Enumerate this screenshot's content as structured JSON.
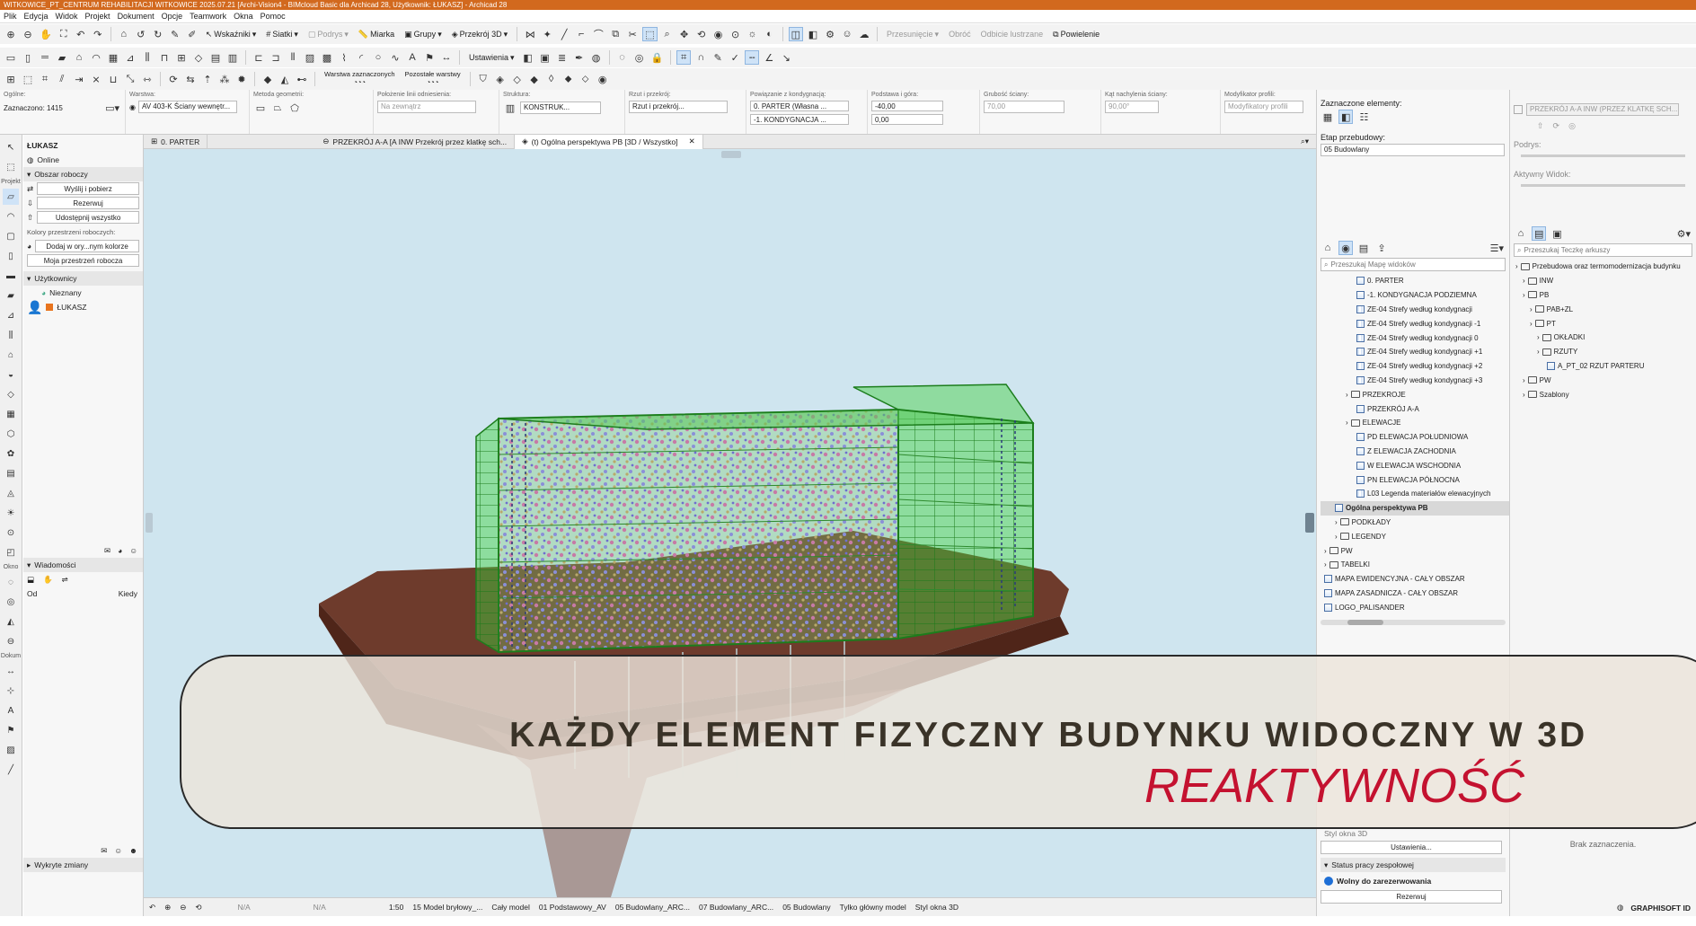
{
  "window": {
    "title": "WITKOWICE_PT_CENTRUM REHABILITACJI WITKOWICE 2025.07.21 [Archi-Vision4 - BIMcloud Basic dla Archicad 28, Użytkownik: ŁUKASZ] - Archicad 28"
  },
  "menu": [
    "Plik",
    "Edycja",
    "Widok",
    "Projekt",
    "Dokument",
    "Opcje",
    "Teamwork",
    "Okna",
    "Pomoc"
  ],
  "toolbar": {
    "wskazniki": "Wskaźniki",
    "siatki": "Siatki",
    "podrys": "Podrys",
    "miarka": "Miarka",
    "grupy": "Grupy",
    "przekroj3d": "Przekrój 3D",
    "przesuniecie": "Przesunięcie",
    "obroc": "Obróć",
    "odbicie": "Odbicie lustrzane",
    "powielenie": "Powielenie",
    "ustawienia": "Ustawienia",
    "warstwa": "Warstwa zaznaczonych",
    "pozostale": "Pozostałe warstwy"
  },
  "infobox": {
    "ogolne": "Ogólne:",
    "zaznaczono": "Zaznaczono: 1415",
    "warstwa_l": "Warstwa:",
    "warstwa_v": "AV 403-K Ściany wewnętr...",
    "metoda_l": "Metoda geometrii:",
    "polozenie_l": "Położenie linii odniesienia:",
    "polozenie_v": "Na zewnątrz",
    "struktura_l": "Struktura:",
    "struktura_v": "KONSTRUK...",
    "rzut_l": "Rzut i przekrój:",
    "rzut_v": "Rzut i przekrój...",
    "powiazanie_l": "Powiązanie z kondygnacją:",
    "pow1": "0. PARTER (Własna ...",
    "pow2": "-1. KONDYGNACJA ...",
    "podstawa_l": "Podstawa i góra:",
    "pod1": "-40,00",
    "pod2": "0,00",
    "grubosc_l": "Grubość ściany:",
    "grubosc_v": "70,00",
    "kat_l": "Kąt nachylenia ściany:",
    "kat_v": "90,00°",
    "modyf_l": "Modyfikator profili:",
    "modyf_v": "Modyfikatory profili"
  },
  "leftpanel": {
    "user": "ŁUKASZ",
    "online": "Online",
    "obszar": "Obszar roboczy",
    "wyslij": "Wyślij i pobierz",
    "rezerwuj": "Rezerwuj",
    "udostepnij": "Udostępnij wszystko",
    "kolory": "Kolory przestrzeni roboczych:",
    "dodaj": "Dodaj w ory...nym kolorze",
    "moja": "Moja przestrzeń robocza",
    "uzytkownicy": "Użytkownicy",
    "nieznany": "Nieznany",
    "lukasz": "ŁUKASZ",
    "wiadomosci": "Wiadomości",
    "od": "Od",
    "kiedy": "Kiedy",
    "wykryte": "Wykryte zmiany"
  },
  "tooltray": {
    "projekt": "Projekt",
    "okno": "Okno",
    "dokument": "Dokum"
  },
  "tabs": [
    "0. PARTER",
    "PRZEKRÓJ A-A [A INW Przekrój przez klatkę sch...",
    "(t) Ogólna perspektywa PB [3D / Wszystko]"
  ],
  "status": [
    "N/A",
    "N/A",
    "1:50",
    "15 Model bryłowy_...",
    "Cały model",
    "01 Podstawowy_AV",
    "05 Budowlany_ARC...",
    "07 Budowlany_ARC...",
    "05 Budowlany",
    "Tylko główny model",
    "Styl okna 3D"
  ],
  "nav": {
    "zaznaczone": "Zaznaczone elementy:",
    "etap_l": "Etap przebudowy:",
    "etap_v": "05 Budowlany",
    "search": "Przeszukaj Mapę widoków",
    "items": [
      {
        "t": "0. PARTER",
        "lvl": 3,
        "k": "view"
      },
      {
        "t": "-1. KONDYGNACJA PODZIEMNA",
        "lvl": 3,
        "k": "view"
      },
      {
        "t": "ZE-04 Strefy według kondygnacji",
        "lvl": 3,
        "k": "grid"
      },
      {
        "t": "ZE-04 Strefy według kondygnacji -1",
        "lvl": 3,
        "k": "grid"
      },
      {
        "t": "ZE-04 Strefy według kondygnacji 0",
        "lvl": 3,
        "k": "grid"
      },
      {
        "t": "ZE-04 Strefy według kondygnacji +1",
        "lvl": 3,
        "k": "grid"
      },
      {
        "t": "ZE-04 Strefy według kondygnacji +2",
        "lvl": 3,
        "k": "grid"
      },
      {
        "t": "ZE-04 Strefy według kondygnacji +3",
        "lvl": 3,
        "k": "grid"
      },
      {
        "t": "PRZEKROJE",
        "lvl": 2,
        "k": "folder"
      },
      {
        "t": "PRZEKRÓJ A-A",
        "lvl": 3,
        "k": "view"
      },
      {
        "t": "ELEWACJE",
        "lvl": 2,
        "k": "folder"
      },
      {
        "t": "PD ELEWACJA POŁUDNIOWA",
        "lvl": 3,
        "k": "view"
      },
      {
        "t": "Z ELEWACJA ZACHODNIA",
        "lvl": 3,
        "k": "view"
      },
      {
        "t": "W ELEWACJA WSCHODNIA",
        "lvl": 3,
        "k": "view"
      },
      {
        "t": "PN ELEWACJA PÓŁNOCNA",
        "lvl": 3,
        "k": "view"
      },
      {
        "t": "L03 Legenda materiałów elewacyjnych",
        "lvl": 3,
        "k": "grid"
      },
      {
        "t": "Ogólna perspektywa PB",
        "lvl": 1,
        "k": "view",
        "sel": true
      },
      {
        "t": "PODKŁADY",
        "lvl": 1,
        "k": "folder"
      },
      {
        "t": "LEGENDY",
        "lvl": 1,
        "k": "folder"
      },
      {
        "t": "PW",
        "lvl": 0,
        "k": "folder"
      },
      {
        "t": "TABELKI",
        "lvl": 0,
        "k": "folder"
      },
      {
        "t": "MAPA EWIDENCYJNA - CAŁY OBSZAR",
        "lvl": 0,
        "k": "view"
      },
      {
        "t": "MAPA ZASADNICZA - CAŁY OBSZAR",
        "lvl": 0,
        "k": "view"
      },
      {
        "t": "LOGO_PALISANDER",
        "lvl": 0,
        "k": "view"
      }
    ],
    "styl": "Styl okna 3D",
    "ustawienia": "Ustawienia...",
    "status_l": "Status pracy zespołowej",
    "wolny": "Wolny do zarezerwowania",
    "rezerwuj": "Rezerwuj"
  },
  "right": {
    "header": "PRZEKRÓJ A-A INW (PRZEZ KLATKĘ SCH...",
    "podrys": "Podrys:",
    "aktywny": "Aktywny Widok:",
    "search": "Przeszukaj Teczkę arkuszy",
    "items": [
      {
        "t": "Przebudowa oraz termomodernizacja budynku",
        "lvl": 0
      },
      {
        "t": "INW",
        "lvl": 1
      },
      {
        "t": "PB",
        "lvl": 1
      },
      {
        "t": "PAB+ZL",
        "lvl": 2
      },
      {
        "t": "PT",
        "lvl": 2
      },
      {
        "t": "OKŁADKI",
        "lvl": 3
      },
      {
        "t": "RZUTY",
        "lvl": 3
      },
      {
        "t": "A_PT_02 RZUT PARTERU",
        "lvl": 4
      },
      {
        "t": "PW",
        "lvl": 1
      },
      {
        "t": "Szablony",
        "lvl": 1
      }
    ],
    "brak": "Brak zaznaczenia.",
    "logo": "GRAPHISOFT ID"
  },
  "overlay": {
    "title": "KAŻDY ELEMENT FIZYCZNY BUDYNKU WIDOCZNY W 3D",
    "subtitle": "REAKTYWNOŚĆ"
  }
}
